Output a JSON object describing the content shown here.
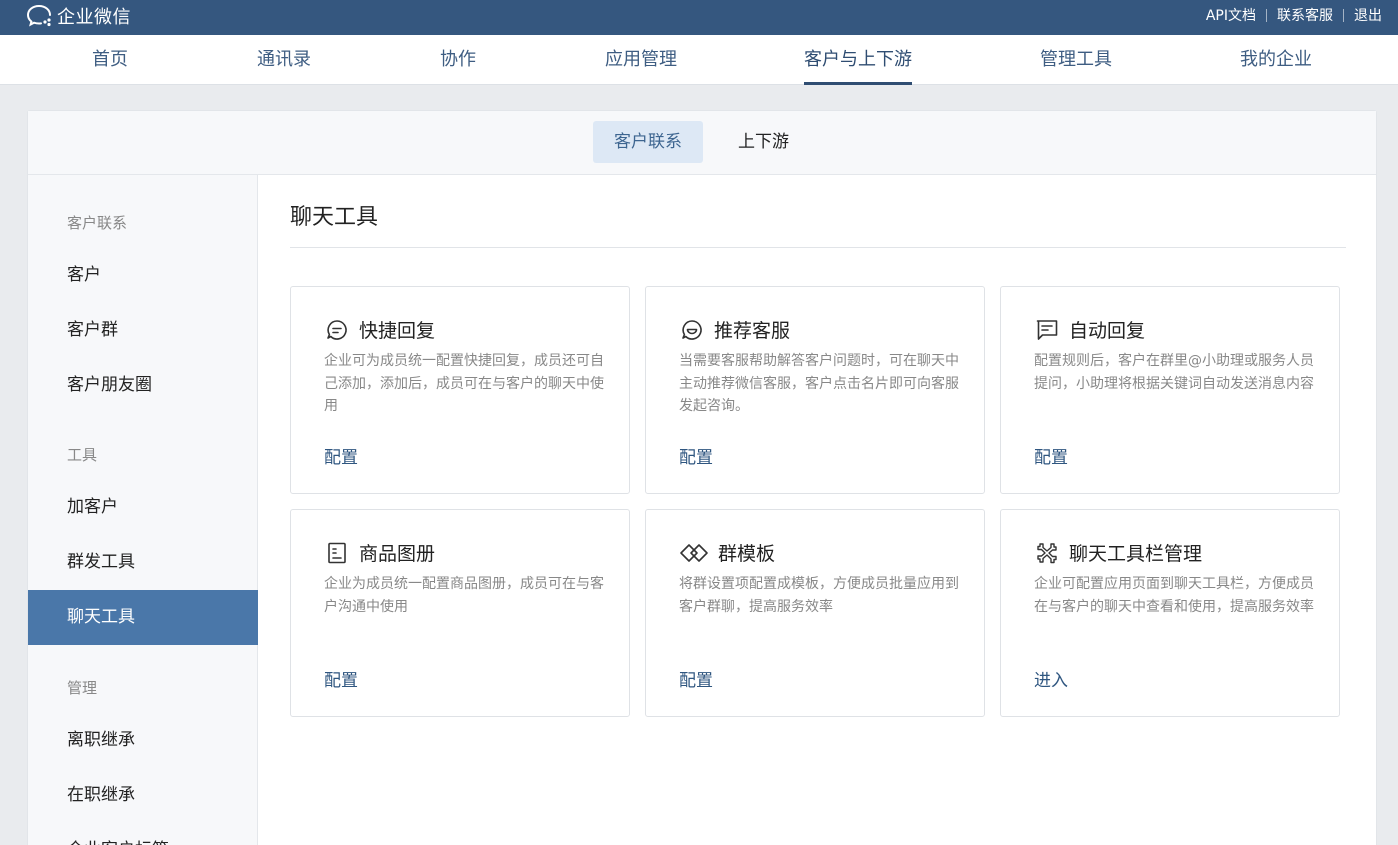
{
  "app": {
    "brand_name": "企业微信"
  },
  "top_links": {
    "api_docs": "API文档",
    "customer_service": "联系客服",
    "logout": "退出"
  },
  "main_nav": {
    "tabs": [
      {
        "label": "首页"
      },
      {
        "label": "通讯录"
      },
      {
        "label": "协作"
      },
      {
        "label": "应用管理"
      },
      {
        "label": "客户与上下游"
      },
      {
        "label": "管理工具"
      },
      {
        "label": "我的企业"
      }
    ],
    "active": "客户与上下游"
  },
  "sub_nav": {
    "tabs": [
      {
        "label": "客户联系"
      },
      {
        "label": "上下游"
      }
    ],
    "active": "客户联系"
  },
  "sidebar": {
    "group_customer": "客户联系",
    "customers": "客户",
    "customer_groups": "客户群",
    "moments": "客户朋友圈",
    "group_tools": "工具",
    "add_customer": "加客户",
    "broadcast": "群发工具",
    "chat_tools": "聊天工具",
    "group_manage": "管理",
    "resign_inherit": "离职继承",
    "onjob_inherit": "在职继承",
    "partial_next": "企业客户标签"
  },
  "content": {
    "title": "聊天工具",
    "cards": [
      {
        "title": "快捷回复",
        "desc": "企业可为成员统一配置快捷回复，成员还可自己添加，添加后，成员可在与客户的聊天中使用",
        "action": "配置",
        "icon": "chat-bubble-icon"
      },
      {
        "title": "推荐客服",
        "desc": "当需要客服帮助解答客户问题时，可在聊天中主动推荐微信客服，客户点击名片即可向客服发起咨询。",
        "action": "配置",
        "icon": "smile-bubble-icon"
      },
      {
        "title": "自动回复",
        "desc": "配置规则后，客户在群里@小助理或服务人员提问，小助理将根据关键词自动发送消息内容",
        "action": "配置",
        "icon": "message-lines-icon"
      },
      {
        "title": "商品图册",
        "desc": "企业为成员统一配置商品图册，成员可在与客户沟通中使用",
        "action": "配置",
        "icon": "catalog-icon"
      },
      {
        "title": "群模板",
        "desc": "将群设置项配置成模板，方便成员批量应用到客户群聊，提高服务效率",
        "action": "配置",
        "icon": "diamond-pair-icon"
      },
      {
        "title": "聊天工具栏管理",
        "desc": "企业可配置应用页面到聊天工具栏，方便成员在与客户的聊天中查看和使用，提高服务效率",
        "action": "进入",
        "icon": "toolbar-manage-icon"
      }
    ]
  },
  "colors": {
    "topbar": "#35577f",
    "accent": "#4a77a9",
    "link": "#2f5680"
  }
}
